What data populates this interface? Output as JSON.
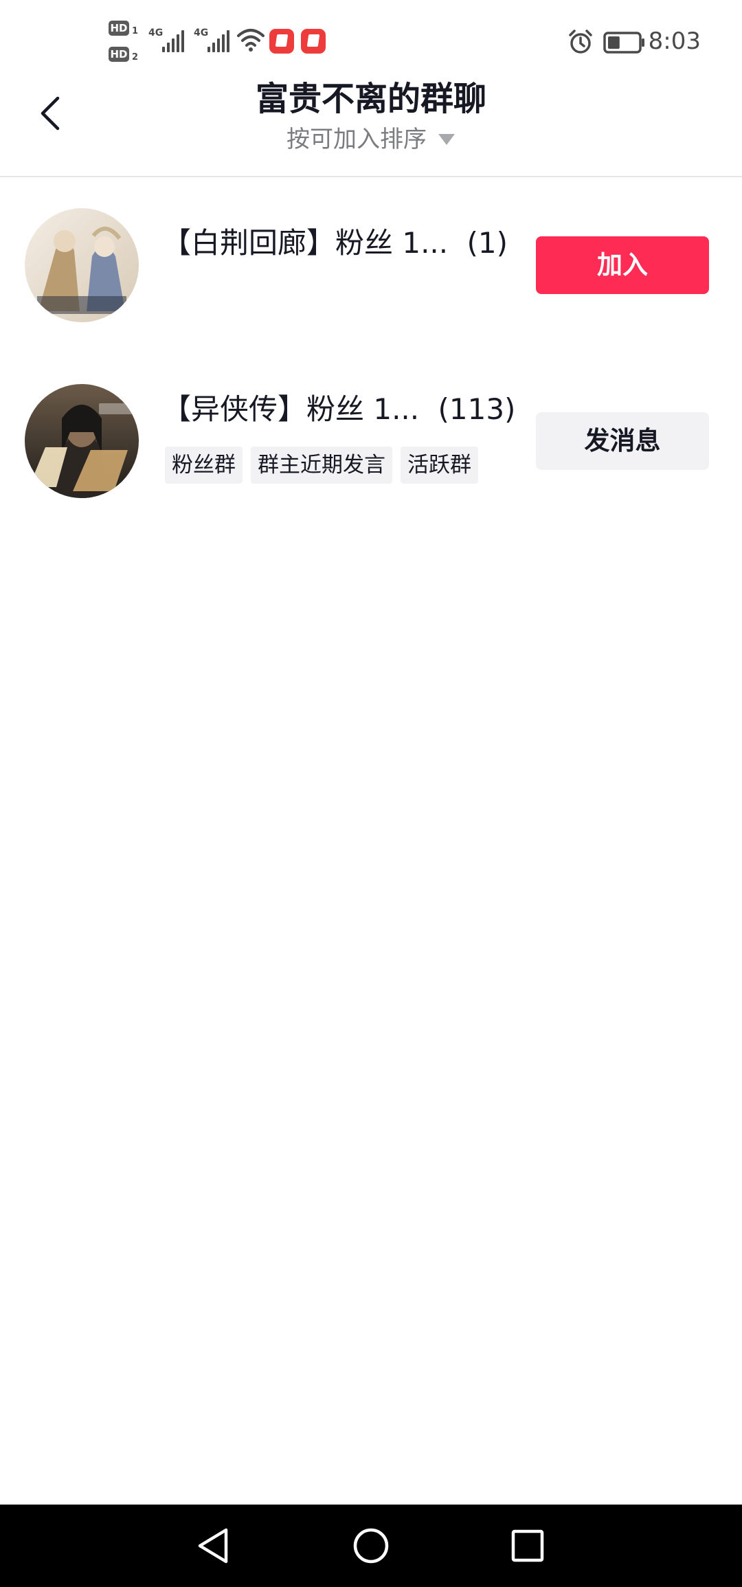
{
  "status_bar": {
    "time": "8:03",
    "sim1_label": "HD",
    "sim1_index": "1",
    "sim2_label": "HD",
    "sim2_index": "2",
    "network1": "4G",
    "network2": "4G",
    "battery_level": 0.4
  },
  "header": {
    "title": "富贵不离的群聊",
    "sort_label": "按可加入排序"
  },
  "groups": [
    {
      "name": "【白荆回廊】粉丝 1...",
      "count": "(1)",
      "tags": [],
      "action_label": "加入",
      "avatar_colors": [
        "#e6ddd2",
        "#c0a98a",
        "#7b8aa8",
        "#2d3340"
      ]
    },
    {
      "name": "【异侠传】粉丝 1...",
      "count": "(113)",
      "tags": [
        "粉丝群",
        "群主近期发言",
        "活跃群"
      ],
      "action_label": "发消息",
      "avatar_colors": [
        "#1f1d1a",
        "#5a4a3a",
        "#c9a36a",
        "#f2e3c0"
      ]
    }
  ],
  "colors": {
    "accent": "#fe2c55",
    "secondary_button": "#f2f2f4",
    "text_primary": "#161823",
    "text_secondary": "#7b7c80"
  },
  "icons": {
    "back": "chevron-left-icon",
    "sort": "triangle-down-icon",
    "alarm": "alarm-clock-icon",
    "battery": "battery-icon",
    "wifi": "wifi-icon",
    "nav_back": "nav-back-icon",
    "nav_home": "nav-home-icon",
    "nav_recents": "nav-recents-icon"
  }
}
